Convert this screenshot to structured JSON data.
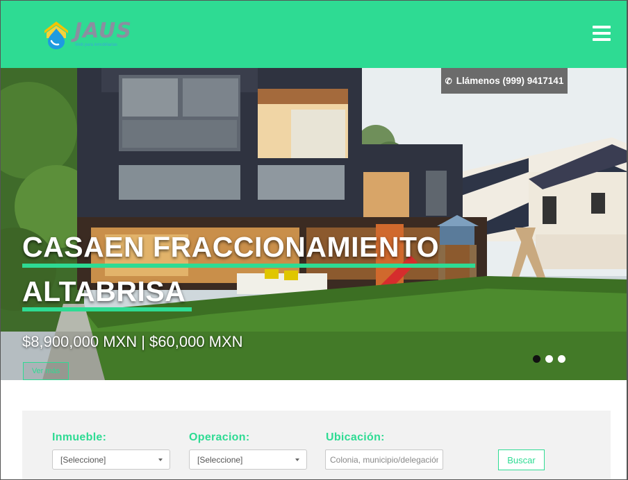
{
  "brand": {
    "name": "JAUS",
    "tagline": "Web para inmobiliarias",
    "primary_color": "#2edb93",
    "text_color": "#8a8fa0"
  },
  "header": {
    "menu_icon": "hamburger-menu-icon"
  },
  "hero": {
    "call_label": "Llámenos (999) 9417141",
    "call_icon": "phone-icon",
    "title_line1": "CASAEN FRACCIONAMIENTO",
    "title_line2": "ALTABRISA",
    "price": "$8,900,000 MXN | $60,000 MXN",
    "cta_label": "Ver más",
    "slides_total": 3,
    "active_slide": 1
  },
  "search": {
    "inmueble": {
      "label": "Inmueble:",
      "value": "[Seleccione]"
    },
    "operacion": {
      "label": "Operacion:",
      "value": "[Seleccione]"
    },
    "ubicacion": {
      "label": "Ubicación:",
      "placeholder": "Colonia, municipio/delegación"
    },
    "button_label": "Buscar"
  }
}
